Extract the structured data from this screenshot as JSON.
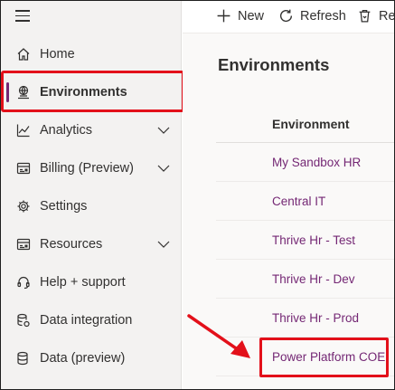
{
  "toolbar": {
    "new_label": "New",
    "refresh_label": "Refresh",
    "recycle_label": "Re"
  },
  "sidebar": {
    "items": [
      {
        "label": "Home",
        "icon": "home-icon"
      },
      {
        "label": "Environments",
        "icon": "environments-icon",
        "selected": true
      },
      {
        "label": "Analytics",
        "icon": "analytics-icon",
        "expandable": true
      },
      {
        "label": "Billing (Preview)",
        "icon": "billing-icon",
        "expandable": true
      },
      {
        "label": "Settings",
        "icon": "gear-icon"
      },
      {
        "label": "Resources",
        "icon": "resources-icon",
        "expandable": true
      },
      {
        "label": "Help + support",
        "icon": "headset-icon"
      },
      {
        "label": "Data integration",
        "icon": "data-integration-icon"
      },
      {
        "label": "Data (preview)",
        "icon": "data-icon"
      }
    ]
  },
  "main": {
    "title": "Environments",
    "grid": {
      "column_header": "Environment",
      "rows": [
        "My Sandbox HR",
        "Central IT",
        "Thrive Hr - Test",
        "Thrive Hr - Dev",
        "Thrive Hr - Prod",
        "Power Platform COE"
      ]
    }
  },
  "colors": {
    "accent": "#742774",
    "annotation": "#e3101a"
  }
}
